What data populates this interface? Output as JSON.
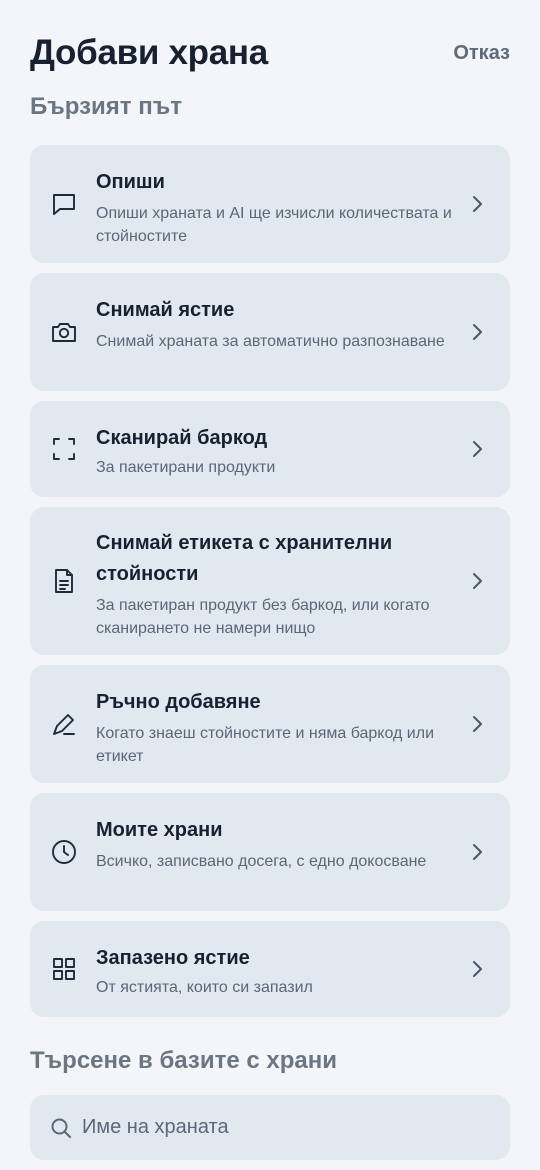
{
  "header": {
    "title": "Добави храна",
    "cancel_label": "Отказ"
  },
  "quick_section": {
    "title": "Бързият път",
    "items": [
      {
        "icon": "chat-bubble-icon",
        "title": "Опиши",
        "subtitle": "Опиши храната и AI ще изчисли количествата и стойностите"
      },
      {
        "icon": "camera-icon",
        "title": "Снимай ястие",
        "subtitle": "Снимай храната за автоматично разпознаване"
      },
      {
        "icon": "barcode-scan-icon",
        "title": "Сканирай баркод",
        "subtitle": "За пакетирани продукти"
      },
      {
        "icon": "document-icon",
        "title": "Снимай етикета с хранителни стойности",
        "subtitle": "За пакетиран продукт без баркод, или когато сканирането не намери нищо"
      },
      {
        "icon": "pencil-icon",
        "title": "Ръчно добавяне",
        "subtitle": "Когато знаеш стойностите и няма баркод или етикет"
      },
      {
        "icon": "clock-icon",
        "title": "Моите храни",
        "subtitle": "Всичко, записвано досега, с едно докосване"
      },
      {
        "icon": "grid-icon",
        "title": "Запазено ястие",
        "subtitle": "От ястията, които си запазил"
      }
    ]
  },
  "search_section": {
    "title": "Търсене в базите с храни",
    "placeholder": "Име на храната",
    "value": ""
  }
}
